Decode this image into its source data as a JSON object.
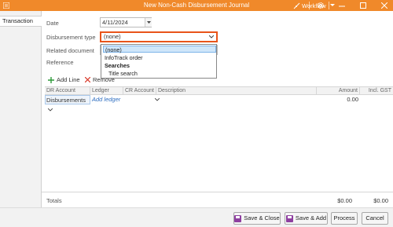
{
  "window": {
    "title": "New Non-Cash Disbursement Journal",
    "workflow_label": "Workflow"
  },
  "nav": {
    "tab_label": "Transaction"
  },
  "form": {
    "date_label": "Date",
    "date_value": "4/11/2024",
    "disbursement_type_label": "Disbursement type",
    "disbursement_type_value": "(none)",
    "related_document_label": "Related document",
    "reference_label": "Reference"
  },
  "dropdown": {
    "options": [
      "(none)",
      "InfoTrack order"
    ],
    "group_label": "Searches",
    "group_child": "Title search"
  },
  "toolbar": {
    "add_line_label": "Add Line",
    "remove_label": "Remove"
  },
  "grid": {
    "headers": [
      "DR Account",
      "Ledger",
      "CR Account",
      "Description",
      "Amount",
      "Incl. GST"
    ],
    "row": {
      "dr_account": "Disbursements",
      "ledger": "Add ledger",
      "amount": "0.00"
    }
  },
  "totals": {
    "label": "Totals",
    "amount": "$0.00",
    "gst": "$0.00"
  },
  "footer": {
    "save_close": "Save & Close",
    "save_add": "Save & Add",
    "process": "Process",
    "cancel": "Cancel"
  },
  "colors": {
    "titlebar": "#f0892a",
    "highlight": "#e8541a",
    "add_icon": "#2e9a3a",
    "remove_icon": "#d93a2b"
  }
}
